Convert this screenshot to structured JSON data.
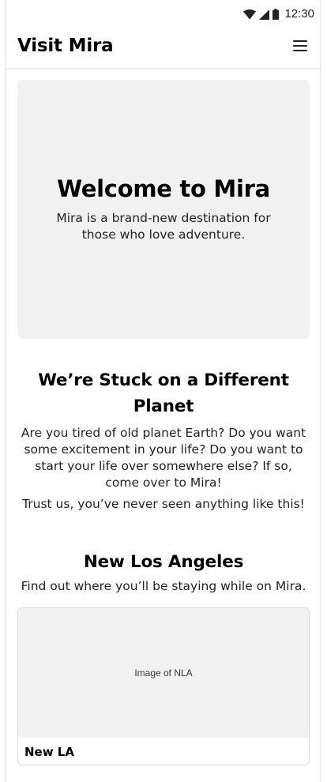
{
  "status_bar": {
    "time": "12:30",
    "icons": [
      "wifi-icon",
      "cellular-signal-icon",
      "battery-icon"
    ]
  },
  "header": {
    "title": "Visit Mira",
    "menu_icon": "hamburger-menu-icon"
  },
  "hero": {
    "title": "Welcome to Mira",
    "text": "Mira is a brand-new destination for those who love adventure."
  },
  "intro": {
    "title": "We’re Stuck on a Different Planet",
    "text": "Are you tired of old planet Earth? Do you want some excitement in your life? Do you want to start your life over somewhere else? If so, come over to Mira!",
    "text2": "Trust us, you’ve never seen anything like this!"
  },
  "city": {
    "title": "New Los Angeles",
    "text": "Find out where you’ll be staying while on Mira.",
    "card": {
      "image_label": "Image of NLA",
      "caption": "New LA"
    }
  },
  "colors": {
    "placeholder_bg": "#f1f1f1",
    "text": "#000000",
    "border": "#dcdcdc"
  }
}
